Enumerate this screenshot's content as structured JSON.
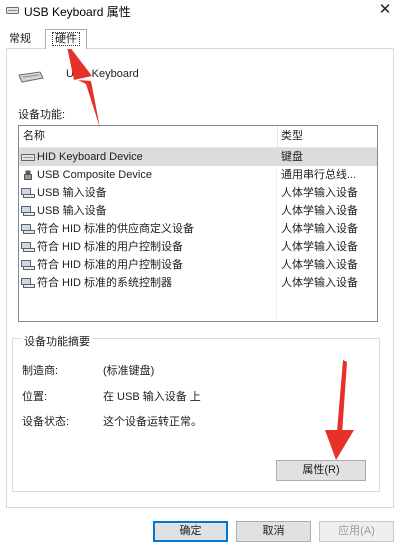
{
  "window": {
    "title": "USB Keyboard 属性",
    "close_glyph": "✕"
  },
  "tabs": [
    {
      "label": "常规"
    },
    {
      "label": "硬件"
    }
  ],
  "device": {
    "name": "USB Keyboard"
  },
  "functions": {
    "label": "设备功能:",
    "columns": {
      "name": "名称",
      "type": "类型"
    },
    "rows": [
      {
        "name": "HID Keyboard Device",
        "type": "键盘",
        "icon": "keyboard-icon"
      },
      {
        "name": "USB Composite Device",
        "type": "通用串行总线...",
        "icon": "usb-icon"
      },
      {
        "name": "USB 输入设备",
        "type": "人体学输入设备",
        "icon": "hid-device-icon"
      },
      {
        "name": "USB 输入设备",
        "type": "人体学输入设备",
        "icon": "hid-device-icon"
      },
      {
        "name": "符合 HID 标准的供应商定义设备",
        "type": "人体学输入设备",
        "icon": "hid-device-icon"
      },
      {
        "name": "符合 HID 标准的用户控制设备",
        "type": "人体学输入设备",
        "icon": "hid-device-icon"
      },
      {
        "name": "符合 HID 标准的用户控制设备",
        "type": "人体学输入设备",
        "icon": "hid-device-icon"
      },
      {
        "name": "符合 HID 标准的系统控制器",
        "type": "人体学输入设备",
        "icon": "hid-device-icon"
      }
    ]
  },
  "summary": {
    "title": "设备功能摘要",
    "manufacturer_label": "制造商:",
    "manufacturer_value": "(标准键盘)",
    "location_label": "位置:",
    "location_value": "在 USB 输入设备 上",
    "status_label": "设备状态:",
    "status_value": "这个设备运转正常。",
    "properties_button": "属性(R)"
  },
  "buttons": {
    "ok": "确定",
    "cancel": "取消",
    "apply": "应用(A)"
  },
  "colors": {
    "selection": "#dcdcdc",
    "ok_border": "#0078d7",
    "annotation_arrow": "#e8302a"
  }
}
